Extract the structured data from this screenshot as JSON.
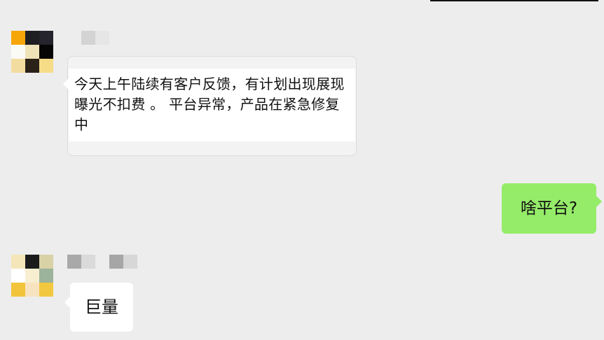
{
  "chat": {
    "messages": [
      {
        "direction": "incoming",
        "text": "今天上午陆续有客户反馈，有计划出现展现曝光不扣费 。 平台异常，产品在紧急修复中"
      },
      {
        "direction": "outgoing",
        "text": "啥平台?"
      },
      {
        "direction": "incoming",
        "text": "巨量"
      }
    ]
  },
  "colors": {
    "background": "#ededed",
    "incoming_bubble": "#ffffff",
    "outgoing_bubble": "#95ec69"
  },
  "icons": [
    "avatar-mosaic",
    "avatar-mosaic"
  ]
}
